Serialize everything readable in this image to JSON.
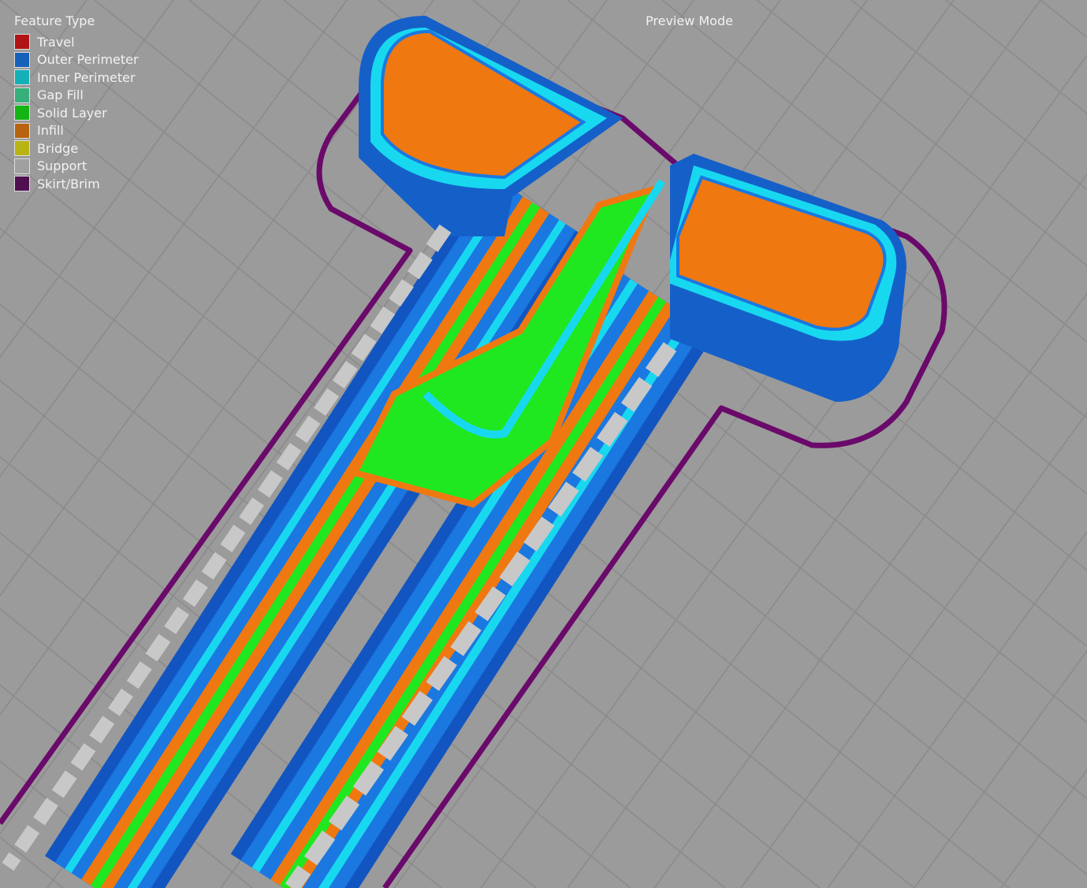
{
  "legend": {
    "title": "Feature Type",
    "items": [
      {
        "label": "Travel",
        "color": "#b01414"
      },
      {
        "label": "Outer Perimeter",
        "color": "#1560b8"
      },
      {
        "label": "Inner Perimeter",
        "color": "#14b0b8"
      },
      {
        "label": "Gap Fill",
        "color": "#36b07a"
      },
      {
        "label": "Solid Layer",
        "color": "#14b414"
      },
      {
        "label": "Infill",
        "color": "#b8640f"
      },
      {
        "label": "Bridge",
        "color": "#b8b414"
      },
      {
        "label": "Support",
        "color": "#a0a0a0"
      },
      {
        "label": "Skirt/Brim",
        "color": "#501050"
      }
    ]
  },
  "mode_label": "Preview Mode",
  "colors": {
    "background": "#9b9b9b",
    "grid": "#8a8a8a",
    "outer": "#1568d8",
    "inner": "#18d8f0",
    "infill": "#f07810",
    "solid": "#20e820",
    "support": "#c8c8c8",
    "skirt": "#6a0a6a"
  }
}
